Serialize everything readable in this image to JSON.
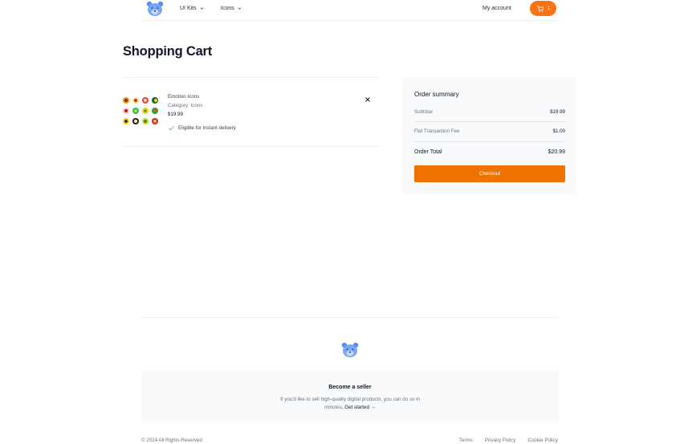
{
  "header": {
    "nav": [
      {
        "label": "UI Kits",
        "icon": "chevron-down-icon"
      },
      {
        "label": "Icons",
        "icon": "chevron-down-icon"
      }
    ],
    "account_label": "My account",
    "cart_count": "1",
    "accent": "#f97316"
  },
  "page": {
    "title": "Shopping Cart"
  },
  "cart": {
    "items": [
      {
        "name": "Emotion Icons",
        "category": "Category: Icons",
        "price": "$19.99",
        "delivery": "Eligible for instant delivery",
        "thumbnail": "emotion-icons-thumbnail"
      }
    ]
  },
  "summary": {
    "title": "Order summary",
    "subtotal_label": "Subtotal",
    "subtotal_value": "$19.99",
    "fee_label": "Flat Transaction Fee",
    "fee_value": "$1.00",
    "total_label": "Order Total",
    "total_value": "$20.99",
    "checkout_label": "Checkout",
    "checkout_color": "#ef7100"
  },
  "footer": {
    "seller_title": "Become a seller",
    "seller_text": "If you'd like to sell high-quality digital products, you can do so in minutes.",
    "seller_link": "Get started →",
    "copyright": "© 2024 All Rights Reserved",
    "links": [
      "Terms",
      "Privacy Policy",
      "Cookie Policy"
    ]
  }
}
